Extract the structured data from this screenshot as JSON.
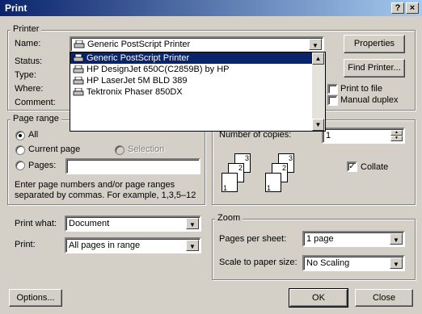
{
  "window": {
    "title": "Print",
    "help_btn": "?",
    "close_btn": "×"
  },
  "printer": {
    "group_label": "Printer",
    "name_label": "Name:",
    "selected": "Generic PostScript Printer",
    "status_label": "Status:",
    "type_label": "Type:",
    "where_label": "Where:",
    "comment_label": "Comment:",
    "options": [
      "Generic PostScript Printer",
      "HP DesignJet 650C(C2859B) by HP",
      "HP LaserJet 5M BLD 389",
      "Tektronix Phaser 850DX"
    ],
    "properties_btn": "Properties",
    "find_printer_btn": "Find Printer...",
    "print_to_file": "Print to file",
    "manual_duplex": "Manual duplex"
  },
  "page_range": {
    "group_label": "Page range",
    "all": "All",
    "current_page": "Current page",
    "selection": "Selection",
    "pages": "Pages:",
    "pages_value": "",
    "help_text_1": "Enter page numbers and/or page ranges",
    "help_text_2": "separated by commas.  For example, 1,3,5–12"
  },
  "copies": {
    "label": "Number of copies:",
    "value": "1",
    "collate": "Collate"
  },
  "print_what": {
    "label": "Print what:",
    "value": "Document"
  },
  "print": {
    "label": "Print:",
    "value": "All pages in range"
  },
  "zoom": {
    "group_label": "Zoom",
    "pages_per_sheet_label": "Pages per sheet:",
    "pages_per_sheet_value": "1 page",
    "scale_label": "Scale to paper size:",
    "scale_value": "No Scaling"
  },
  "buttons": {
    "options": "Options...",
    "ok": "OK",
    "close": "Close"
  },
  "collate_pages": [
    "1",
    "2",
    "3",
    "1",
    "2",
    "3"
  ]
}
